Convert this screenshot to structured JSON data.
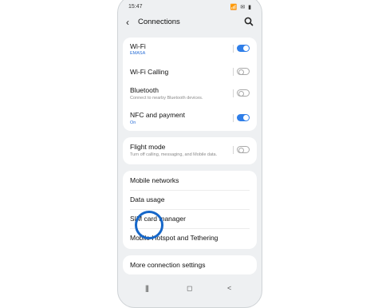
{
  "status_bar": {
    "time": "15:47",
    "icons": "📶 ✉ ▮"
  },
  "header": {
    "title": "Connections"
  },
  "rows": {
    "wifi": {
      "label": "Wi-Fi",
      "sub": "EMASA",
      "state": "on"
    },
    "wifi_calling": {
      "label": "Wi-Fi Calling",
      "state": "off"
    },
    "bluetooth": {
      "label": "Bluetooth",
      "sub": "Connect to nearby Bluetooth devices.",
      "state": "off"
    },
    "nfc": {
      "label": "NFC and payment",
      "sub": "On",
      "state": "on"
    },
    "flight": {
      "label": "Flight mode",
      "sub": "Turn off calling, messaging, and Mobile data.",
      "state": "off"
    },
    "mobile_networks": {
      "label": "Mobile networks"
    },
    "data_usage": {
      "label": "Data usage"
    },
    "sim_manager": {
      "label": "SIM card manager"
    },
    "hotspot": {
      "label": "Mobile Hotspot and Tethering"
    },
    "more": {
      "label": "More connection settings"
    }
  },
  "navbar": {
    "recents": "|||",
    "home": "◻",
    "back": "<"
  },
  "colors": {
    "accent": "#2f7ee8",
    "highlight_circle": "#1667c9"
  }
}
